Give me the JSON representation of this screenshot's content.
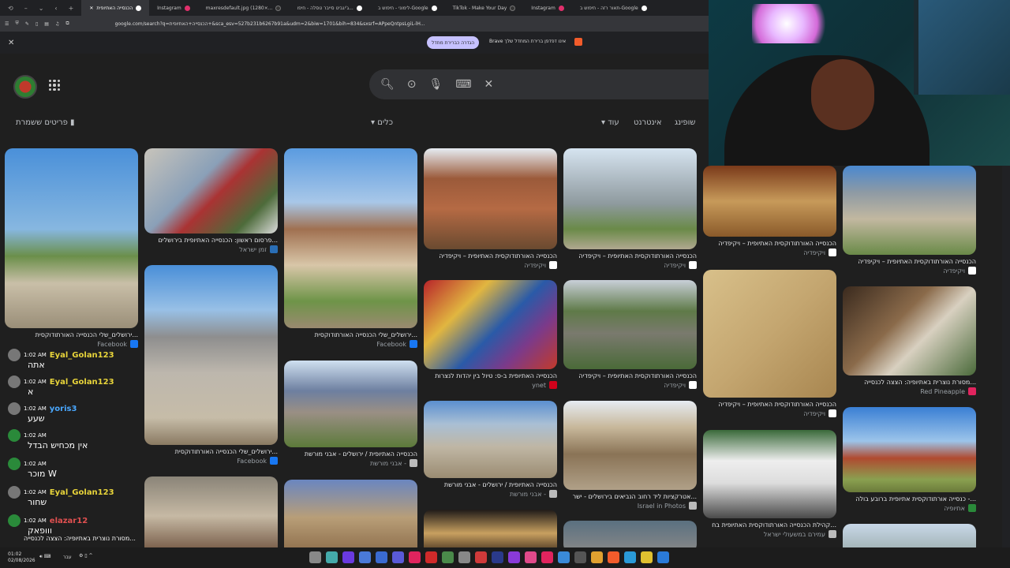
{
  "tabs": [
    {
      "label": "הכנסייה האתיופית"
    },
    {
      "label": "Instagram"
    },
    {
      "label": "maxresdefault.jpg (1280×..."
    },
    {
      "label": "ג'יגביט סייבר טסלה - חיפו..."
    },
    {
      "label": "לימוני - חיפוש ב-Google"
    },
    {
      "label": "TikTok - Make Your Day"
    },
    {
      "label": "Instagram"
    },
    {
      "label": "תאור רזה - חיפוש ב-Google"
    }
  ],
  "address": {
    "url": "google.com/search?q=הכנסייה+האתיופית+&sca_esv=527b231b6267b91a&udm=2&biw=1701&bih=834&sxsrf=APpeQntpsLgiL-lH..."
  },
  "notification": {
    "message": "Brave אינו דפדפן ברירת המחדל שלך",
    "button": "הגדרה כברירת מחדל"
  },
  "filters": {
    "shopping": "שופינג",
    "internet": "אינטרנט",
    "more": "עוד",
    "tools": "כלים",
    "saved": "פריטים ששמרת"
  },
  "results": [
    {
      "caption": "ירושלים_שלי הכנסייה האורתודוקסית...",
      "source": "Facebook"
    },
    {
      "caption": "פרסום ראשון: הכנסייה האתיופית בירושלים...",
      "source": "זמן ישראל"
    },
    {
      "caption": "ירושלים_שלי הכנסייה האורתודוקסית...",
      "source": "Facebook"
    },
    {
      "caption": "ירושלים_שלי הכנסייה האורתודוקסית...",
      "source": "Facebook"
    },
    {
      "caption": "הכנסייה האתיופית / ירושלים - אבני מורשת",
      "source": "אבני מורשת -"
    },
    {
      "caption": "הכנסייה האורתודוקסית האתיופית – ויקיפדיה",
      "source": "ויקיפדיה"
    },
    {
      "caption": "הכנסייה האתיופית ב-ס: טיול בין יהדות לנצרות",
      "source": "ynet"
    },
    {
      "caption": "הכנסייה האתיופית / ירושלים - אבני מורשת",
      "source": "אבני מורשת -"
    },
    {
      "caption": "הכנסייה האורתודוקסית האתיופית – ויקיפדיה",
      "source": "ויקיפדיה"
    },
    {
      "caption": "הכנסייה האורתודוקסית האתיופית – ויקיפדיה",
      "source": "ויקיפדיה"
    },
    {
      "caption": "אטרקציות ליד רחוב הנביאים בירושלים - ישר...",
      "source": "Israel in Photos"
    },
    {
      "caption": "הכנסייה האורתודוקסית האתיופית – ויקיפדיה",
      "source": "ויקיפדיה"
    },
    {
      "caption": "הכנסייה האורתודוקסית האתיופית – ויקיפדיה",
      "source": "ויקיפדיה"
    },
    {
      "caption": "קהילת הכנסייה האורתודוקסית האתיופית בח...",
      "source": "עמירם במשעולי ישראל"
    },
    {
      "caption": "הכנסייה האורתודוקסית האתיופית – ויקיפדיה",
      "source": "ויקיפדיה"
    },
    {
      "caption": "מסורת נוצרית באתיופיה: הצצה לכנסייה...",
      "source": "Red Pineapple"
    },
    {
      "caption": "כנסייה אורתודוקסית אתיופית ברובע בולה -...",
      "source": "אתיופיה"
    }
  ],
  "chat": [
    {
      "time": "1:02 AM",
      "user": "Eyal_Golan123",
      "msg": "אתה"
    },
    {
      "time": "1:02 AM",
      "user": "Eyal_Golan123",
      "msg": "א"
    },
    {
      "time": "1:02 AM",
      "user": "yoris3",
      "msg": "שעע"
    },
    {
      "time": "1:02 AM",
      "user": "",
      "msg": "אין מכחיש הבדל"
    },
    {
      "time": "1:02 AM",
      "user": "",
      "msg": "מוכר W"
    },
    {
      "time": "1:02 AM",
      "user": "Eyal_Golan123",
      "msg": "שחור"
    },
    {
      "time": "1:02 AM",
      "user": "elazar12",
      "msg": "ווופאק"
    }
  ],
  "bottom_caption": "מסורת נוצרית באתיופיה: הצצה לכנסייה...",
  "taskbar": {
    "time": "01:02",
    "date": "02/08/2026",
    "lang": "עבר"
  }
}
